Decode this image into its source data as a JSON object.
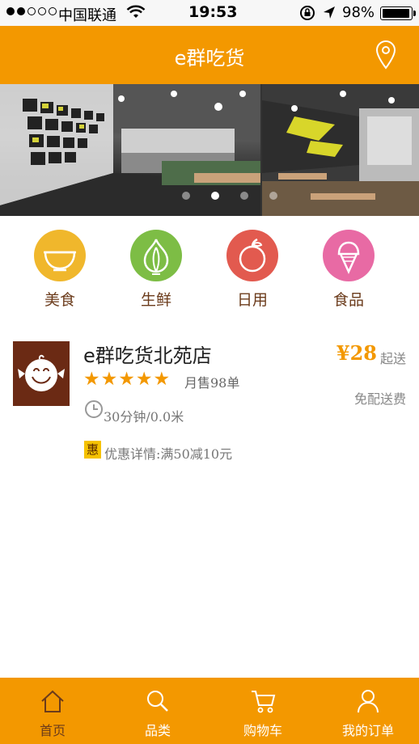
{
  "status_bar": {
    "carrier": "中国联通",
    "time": "19:53",
    "battery": "98%",
    "battery_level": 0.98
  },
  "header": {
    "title": "e群吃货",
    "location_icon": "location-pin-icon"
  },
  "banner": {
    "dot_count": 4,
    "active_index": 1
  },
  "categories": [
    {
      "label": "美食",
      "icon": "bowl-icon",
      "color": "#f0b72c"
    },
    {
      "label": "生鲜",
      "icon": "garlic-icon",
      "color": "#7dbd45"
    },
    {
      "label": "日用",
      "icon": "fruit-icon",
      "color": "#e25a4f"
    },
    {
      "label": "食品",
      "icon": "ice-cream-icon",
      "color": "#e86aa4"
    }
  ],
  "shop": {
    "name": "e群吃货北苑店",
    "rating": 5,
    "sales": "月售98单",
    "time_distance": "30分钟/0.0米",
    "promo_badge": "惠",
    "promo": "优惠详情:满50减10元",
    "min_price": "¥28",
    "min_price_suffix": "起送",
    "delivery": "免配送费"
  },
  "tabbar": {
    "items": [
      {
        "label": "首页",
        "icon": "home-icon",
        "active": true
      },
      {
        "label": "品类",
        "icon": "search-icon",
        "active": false
      },
      {
        "label": "购物车",
        "icon": "cart-icon",
        "active": false
      },
      {
        "label": "我的订单",
        "icon": "user-icon",
        "active": false
      }
    ]
  },
  "colors": {
    "brand": "#f39800",
    "accent_text": "#6b3b1b"
  }
}
